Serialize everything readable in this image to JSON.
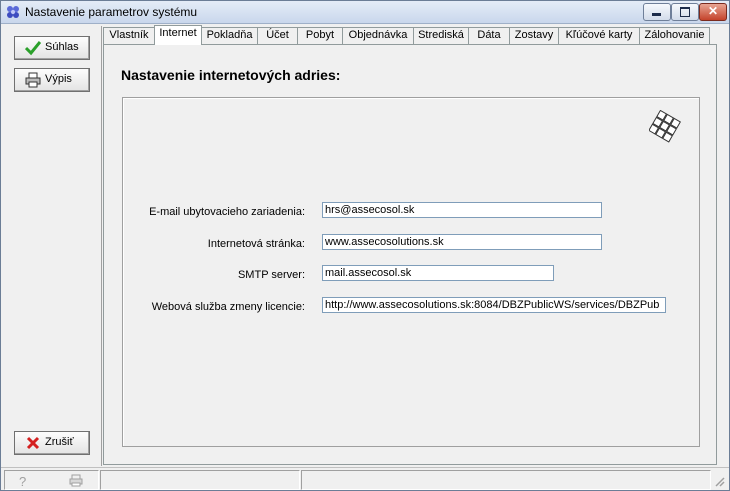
{
  "window": {
    "title": "Nastavenie parametrov systému",
    "close_glyph": "✕"
  },
  "sidebar": {
    "buttons": [
      {
        "label": "Súhlas",
        "icon": "check-icon"
      },
      {
        "label": "Výpis",
        "icon": "printer-icon"
      },
      {
        "label": "Zrušiť",
        "icon": "x-icon"
      }
    ]
  },
  "tabs": [
    {
      "label": "Vlastník",
      "active": false
    },
    {
      "label": "Internet",
      "active": true
    },
    {
      "label": "Pokladňa",
      "active": false
    },
    {
      "label": "Účet",
      "active": false
    },
    {
      "label": "Pobyt",
      "active": false
    },
    {
      "label": "Objednávka",
      "active": false
    },
    {
      "label": "Strediská",
      "active": false
    },
    {
      "label": "Dáta",
      "active": false
    },
    {
      "label": "Zostavy",
      "active": false
    },
    {
      "label": "Kľúčové karty",
      "active": false
    },
    {
      "label": "Zálohovanie",
      "active": false
    }
  ],
  "internet": {
    "heading": "Nastavenie internetových adries:",
    "fields": [
      {
        "label": "E-mail ubytovacieho zariadenia:",
        "value": "hrs@assecosol.sk"
      },
      {
        "label": "Internetová stránka:",
        "value": "www.assecosolutions.sk"
      },
      {
        "label": "SMTP server:",
        "value": "mail.assecosol.sk"
      },
      {
        "label": "Webová služba zmeny licencie:",
        "value": "http://www.assecosolutions.sk:8084/DBZPublicWS/services/DBZPub"
      }
    ]
  },
  "statusbar": {
    "help_icon": "?",
    "print_icon": "printer-icon"
  }
}
